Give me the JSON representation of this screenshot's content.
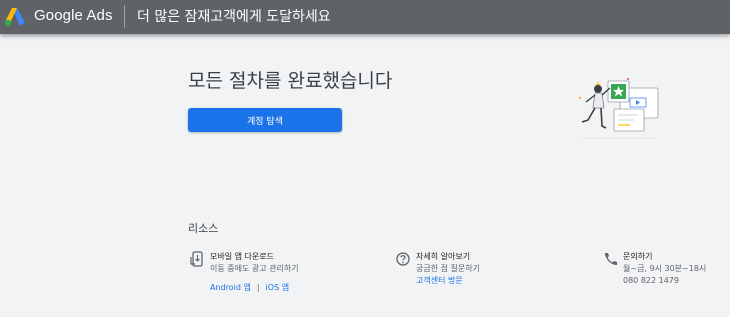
{
  "header": {
    "brand": "Google Ads",
    "tagline": "더 많은 잠재고객에게 도달하세요"
  },
  "main": {
    "headline": "모든 절차를 완료했습니다",
    "explore_button": "계정 탐색"
  },
  "resources": {
    "title": "리소스",
    "mobile": {
      "title": "모바일 앱 다운로드",
      "subtitle": "이동 중에도 광고 관리하기",
      "android_link": "Android 앱",
      "separator": "|",
      "ios_link": "iOS 앱"
    },
    "learn": {
      "title": "자세히 알아보기",
      "subtitle": "궁금한 점 질문하기",
      "link": "고객센터 방문"
    },
    "contact": {
      "title": "문의하기",
      "hours": "월~금, 9시 30분~18시",
      "phone": "080 822 1479"
    }
  },
  "colors": {
    "topbar": "#5f6368",
    "background": "#f1f3f4",
    "accent": "#1a73e8",
    "success": "#34a853"
  }
}
